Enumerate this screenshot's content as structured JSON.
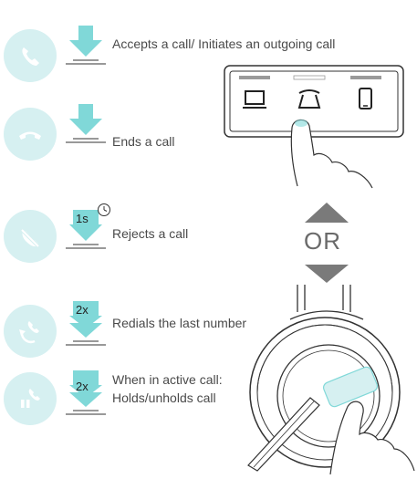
{
  "rows": [
    {
      "label": "Accepts a call/ Initiates an outgoing call"
    },
    {
      "label": "Ends a call"
    },
    {
      "label": "Rejects a call",
      "badge": "1s"
    },
    {
      "label": "Redials the last number",
      "badge": "2x"
    },
    {
      "label_line1": "When in active call:",
      "label_line2": "Holds/unholds call",
      "badge": "2x"
    }
  ],
  "or_label": "OR",
  "colors": {
    "accent": "#80d8d8",
    "circle_bg": "#d6f0f1",
    "icon": "#ffffff",
    "line": "#333333",
    "text": "#4a4a4a"
  }
}
